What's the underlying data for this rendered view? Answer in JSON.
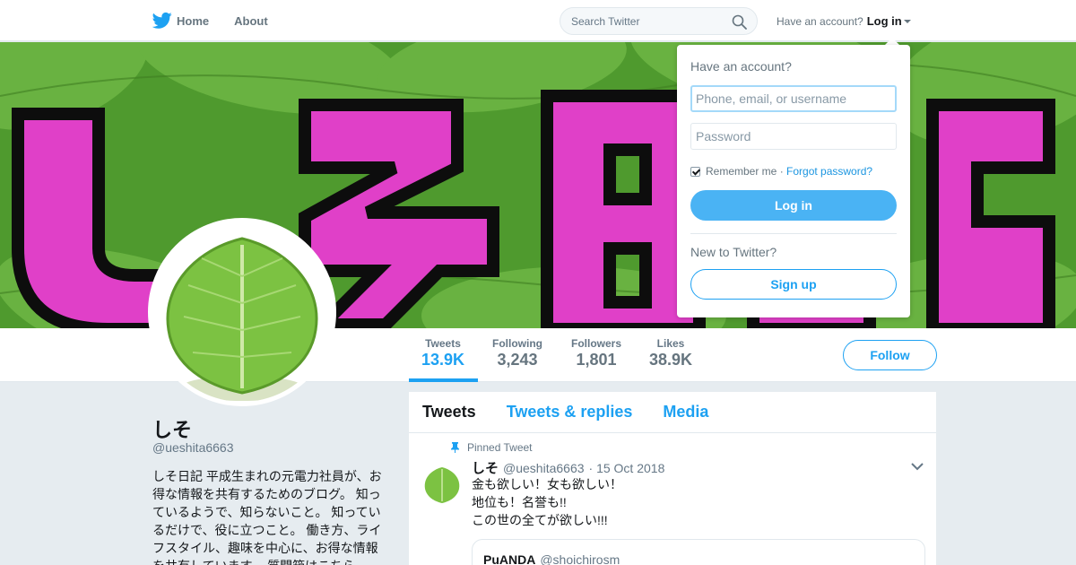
{
  "nav": {
    "home_label": "Home",
    "about_label": "About",
    "search_placeholder": "Search Twitter",
    "account_prompt": "Have an account?",
    "login_label": "Log in"
  },
  "banner": {
    "text": "しそ日記",
    "colors": {
      "leaf": "#5fa73a",
      "letters": "#e040c8",
      "outline": "#0d0d0d"
    }
  },
  "profile": {
    "name": "しそ",
    "handle": "@ueshita6663",
    "bio": "しそ日記 平成生まれの元電力社員が、お得な情報を共有するためのブログ。 知っているようで、知らないこと。 知っているだけで、役に立つこと。 働き方、ライフスタイル、趣味を中心に、お得な情報を共有しています。 質問箱はこちら"
  },
  "stats": [
    {
      "label": "Tweets",
      "value": "13.9K",
      "active": true
    },
    {
      "label": "Following",
      "value": "3,243",
      "active": false
    },
    {
      "label": "Followers",
      "value": "1,801",
      "active": false
    },
    {
      "label": "Likes",
      "value": "38.9K",
      "active": false
    }
  ],
  "follow_label": "Follow",
  "timeline": {
    "tabs": [
      "Tweets",
      "Tweets & replies",
      "Media"
    ],
    "pinned_label": "Pinned Tweet",
    "tweet": {
      "name": "しそ",
      "handle": "@ueshita6663",
      "date": "· 15 Oct 2018",
      "lines": [
        "金も欲しい！女も欲しい！",
        "地位も！名誉も!!",
        "この世の全てが欲しい!!!"
      ]
    },
    "quote": {
      "name": "PuANDA",
      "handle": "@shoichirosm"
    }
  },
  "login_dropdown": {
    "title": "Have an account?",
    "username_placeholder": "Phone, email, or username",
    "password_placeholder": "Password",
    "remember_label": "Remember me",
    "separator": " · ",
    "forgot_label": "Forgot password?",
    "login_button": "Log in",
    "new_prompt": "New to Twitter?",
    "signup_button": "Sign up"
  },
  "colors": {
    "accent": "#1da1f2",
    "login_button": "#4ab3f4"
  }
}
